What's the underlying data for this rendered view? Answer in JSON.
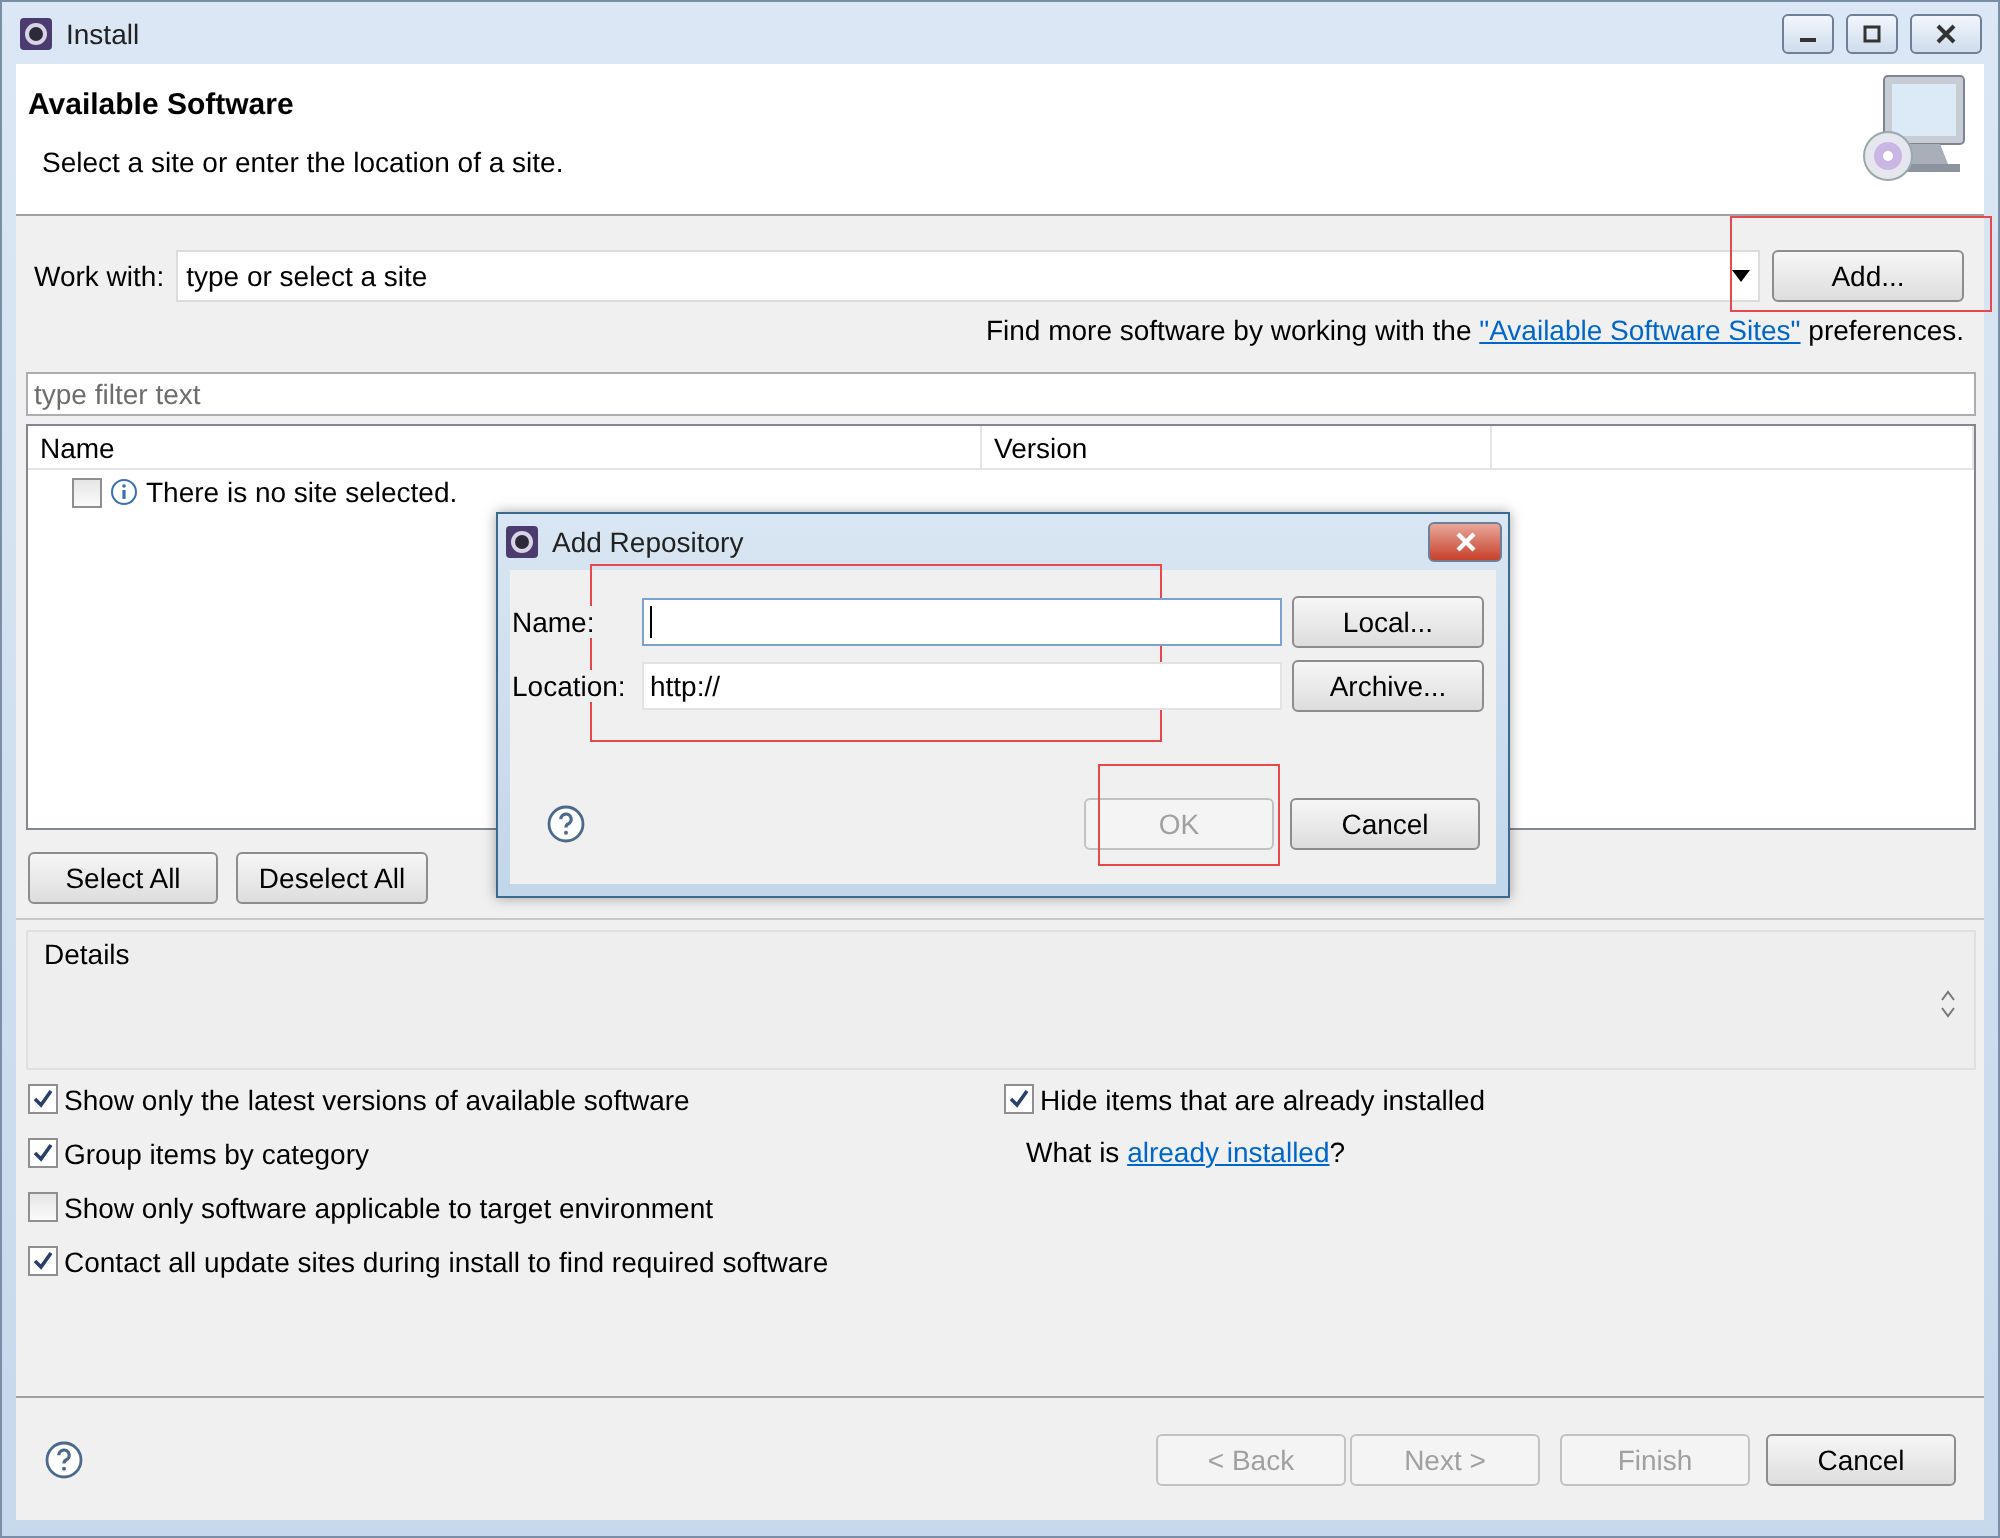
{
  "window": {
    "title": "Install"
  },
  "header": {
    "title": "Available Software",
    "subtitle": "Select a site or enter the location of a site."
  },
  "work_with": {
    "label": "Work with:",
    "placeholder": "type or select a site",
    "add_button": {
      "label": "Add...",
      "highlighted": true
    }
  },
  "hint": {
    "before": "Find more software by working with the ",
    "link": "\"Available Software Sites\"",
    "after": " preferences."
  },
  "filter": {
    "placeholder": "type filter text"
  },
  "table": {
    "columns": [
      "Name",
      "Version"
    ],
    "rows": [
      {
        "name": "There is no site selected.",
        "checked": false
      }
    ]
  },
  "selection_buttons": [
    "Select All",
    "Deselect All"
  ],
  "details": {
    "label": "Details"
  },
  "options_left": [
    {
      "label": "Show only the latest versions of available software",
      "checked": true
    },
    {
      "label": "Group items by category",
      "checked": true
    },
    {
      "label": "Show only software applicable to target environment",
      "checked": false
    },
    {
      "label": "Contact all update sites during install to find required software",
      "checked": true
    }
  ],
  "options_right": [
    {
      "label": "Hide items that are already installed",
      "checked": true
    }
  ],
  "installed_note": {
    "before": "What is ",
    "link": "already installed",
    "after": "?"
  },
  "footer_buttons": [
    {
      "label": "< Back",
      "disabled": true
    },
    {
      "label": "Next >",
      "disabled": true
    },
    {
      "label": "Finish",
      "disabled": true
    },
    {
      "label": "Cancel",
      "disabled": false
    }
  ],
  "dialog": {
    "title": "Add Repository",
    "fields_highlighted": true,
    "fields": [
      {
        "label": "Name:",
        "focused": true,
        "button": "Local..."
      },
      {
        "label": "Location:",
        "value": "http://",
        "focused": false,
        "button": "Archive..."
      }
    ],
    "buttons": [
      {
        "label": "OK",
        "disabled": true,
        "highlighted": true
      },
      {
        "label": "Cancel",
        "disabled": false,
        "highlighted": false
      }
    ]
  }
}
